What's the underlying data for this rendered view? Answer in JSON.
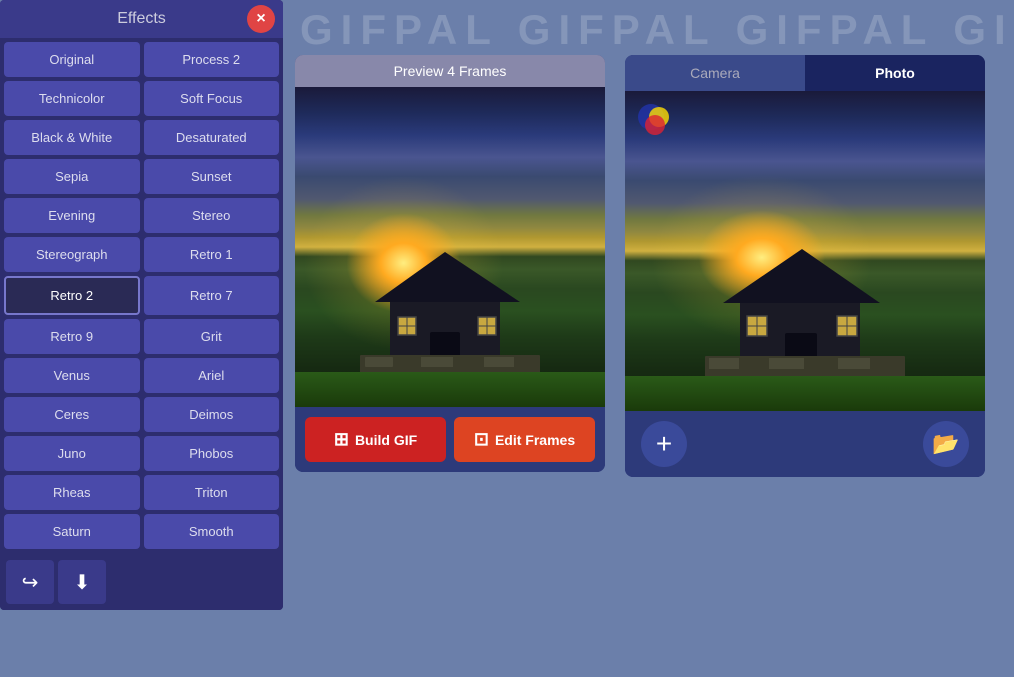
{
  "watermark": {
    "text": "GIFPAL GIFPAL GIFPAL GIFPA"
  },
  "effects_panel": {
    "title": "Effects",
    "close_label": "×",
    "buttons": [
      {
        "id": "original",
        "label": "Original",
        "col": 0
      },
      {
        "id": "process2",
        "label": "Process 2",
        "col": 1
      },
      {
        "id": "technicolor",
        "label": "Technicolor",
        "col": 0
      },
      {
        "id": "soft-focus",
        "label": "Soft Focus",
        "col": 1
      },
      {
        "id": "black-white",
        "label": "Black & White",
        "col": 0
      },
      {
        "id": "desaturated",
        "label": "Desaturated",
        "col": 1
      },
      {
        "id": "sepia",
        "label": "Sepia",
        "col": 0
      },
      {
        "id": "sunset",
        "label": "Sunset",
        "col": 1
      },
      {
        "id": "evening",
        "label": "Evening",
        "col": 0
      },
      {
        "id": "stereo",
        "label": "Stereo",
        "col": 1
      },
      {
        "id": "stereograph",
        "label": "Stereograph",
        "col": 0
      },
      {
        "id": "retro1",
        "label": "Retro 1",
        "col": 1
      },
      {
        "id": "retro2",
        "label": "Retro 2",
        "col": 0,
        "active": true
      },
      {
        "id": "retro7",
        "label": "Retro 7",
        "col": 1
      },
      {
        "id": "retro9",
        "label": "Retro 9",
        "col": 0
      },
      {
        "id": "grit",
        "label": "Grit",
        "col": 1
      },
      {
        "id": "venus",
        "label": "Venus",
        "col": 0
      },
      {
        "id": "ariel",
        "label": "Ariel",
        "col": 1
      },
      {
        "id": "ceres",
        "label": "Ceres",
        "col": 0
      },
      {
        "id": "deimos",
        "label": "Deimos",
        "col": 1
      },
      {
        "id": "juno",
        "label": "Juno",
        "col": 0
      },
      {
        "id": "phobos",
        "label": "Phobos",
        "col": 1
      },
      {
        "id": "rheas",
        "label": "Rheas",
        "col": 0
      },
      {
        "id": "triton",
        "label": "Triton",
        "col": 1
      },
      {
        "id": "saturn",
        "label": "Saturn",
        "col": 0
      },
      {
        "id": "smooth",
        "label": "Smooth",
        "col": 1
      }
    ],
    "toolbar": {
      "share_label": "↪",
      "download_label": "⬇"
    }
  },
  "preview_panel": {
    "header": "Preview 4 Frames",
    "build_gif_label": "Build GIF",
    "edit_frames_label": "Edit Frames"
  },
  "photo_panel": {
    "tabs": [
      {
        "id": "camera",
        "label": "Camera"
      },
      {
        "id": "photo",
        "label": "Photo",
        "active": true
      }
    ],
    "add_label": "+",
    "folder_label": "🗂"
  }
}
